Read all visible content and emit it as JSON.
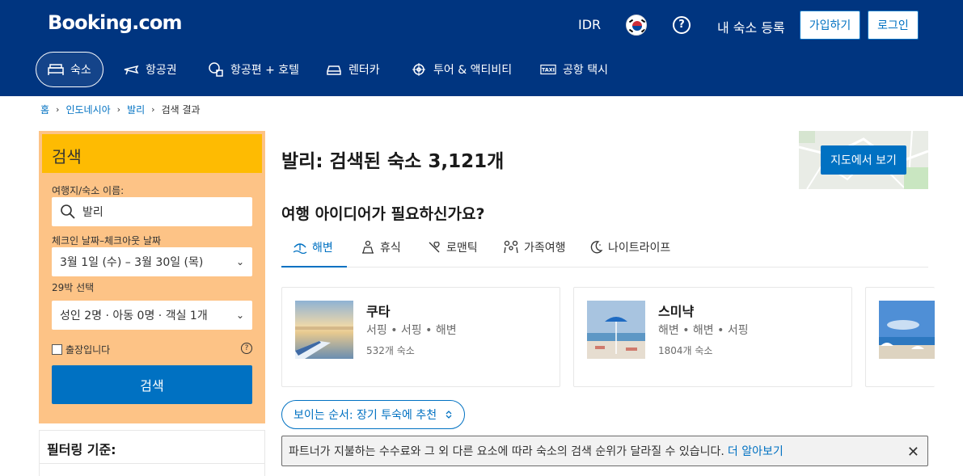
{
  "header": {
    "logo": "Booking.com",
    "currency": "IDR",
    "list_property": "내 숙소 등록",
    "register": "가입하기",
    "login": "로그인"
  },
  "nav": [
    {
      "label": "숙소",
      "icon": "bed-icon"
    },
    {
      "label": "항공권",
      "icon": "plane-icon"
    },
    {
      "label": "항공편 + 호텔",
      "icon": "plane-hotel-icon"
    },
    {
      "label": "렌터카",
      "icon": "car-icon"
    },
    {
      "label": "투어 & 액티비티",
      "icon": "attraction-icon"
    },
    {
      "label": "공항 택시",
      "icon": "taxi-icon"
    }
  ],
  "breadcrumb": [
    "홈",
    "인도네시아",
    "발리",
    "검색 결과"
  ],
  "search": {
    "title": "검색",
    "dest_label": "여행지/숙소 이름:",
    "dest_value": "발리",
    "dates_label": "체크인 날짜–체크아웃 날짜",
    "dates_value": "3월 1일 (수) – 3월 30일 (목)",
    "nights": "29박 선택",
    "guests": "성인 2명 · 아동 0명 · 객실 1개",
    "business": "출장입니다",
    "button": "검색"
  },
  "filter": {
    "title": "필터링 기준:"
  },
  "main": {
    "title": "발리: 검색된 숙소 3,121개",
    "map_button": "지도에서 보기",
    "ideas_title": "여행 아이디어가 필요하신가요?",
    "tabs": [
      {
        "label": "해변",
        "icon": "beach-icon"
      },
      {
        "label": "휴식",
        "icon": "relax-icon"
      },
      {
        "label": "로맨틱",
        "icon": "romance-icon"
      },
      {
        "label": "가족여행",
        "icon": "family-icon"
      },
      {
        "label": "나이트라이프",
        "icon": "nightlife-icon"
      }
    ],
    "cards": [
      {
        "name": "쿠타",
        "tags": "서핑 • 서핑 • 해변",
        "count": "532개 숙소"
      },
      {
        "name": "스미냑",
        "tags": "해변 • 해변 • 서핑",
        "count": "1804개 숙소"
      }
    ],
    "sort": "보이는 순서: 장기 투숙에 추천",
    "notice": "파트너가 지불하는 수수료와 그 외 다른 요소에 따라 숙소의 검색 순위가 달라질 수 있습니다.",
    "notice_link": "더 알아보기"
  },
  "colors": {
    "brand": "#003580",
    "accent": "#0071c2",
    "search_bg": "#febb02"
  }
}
